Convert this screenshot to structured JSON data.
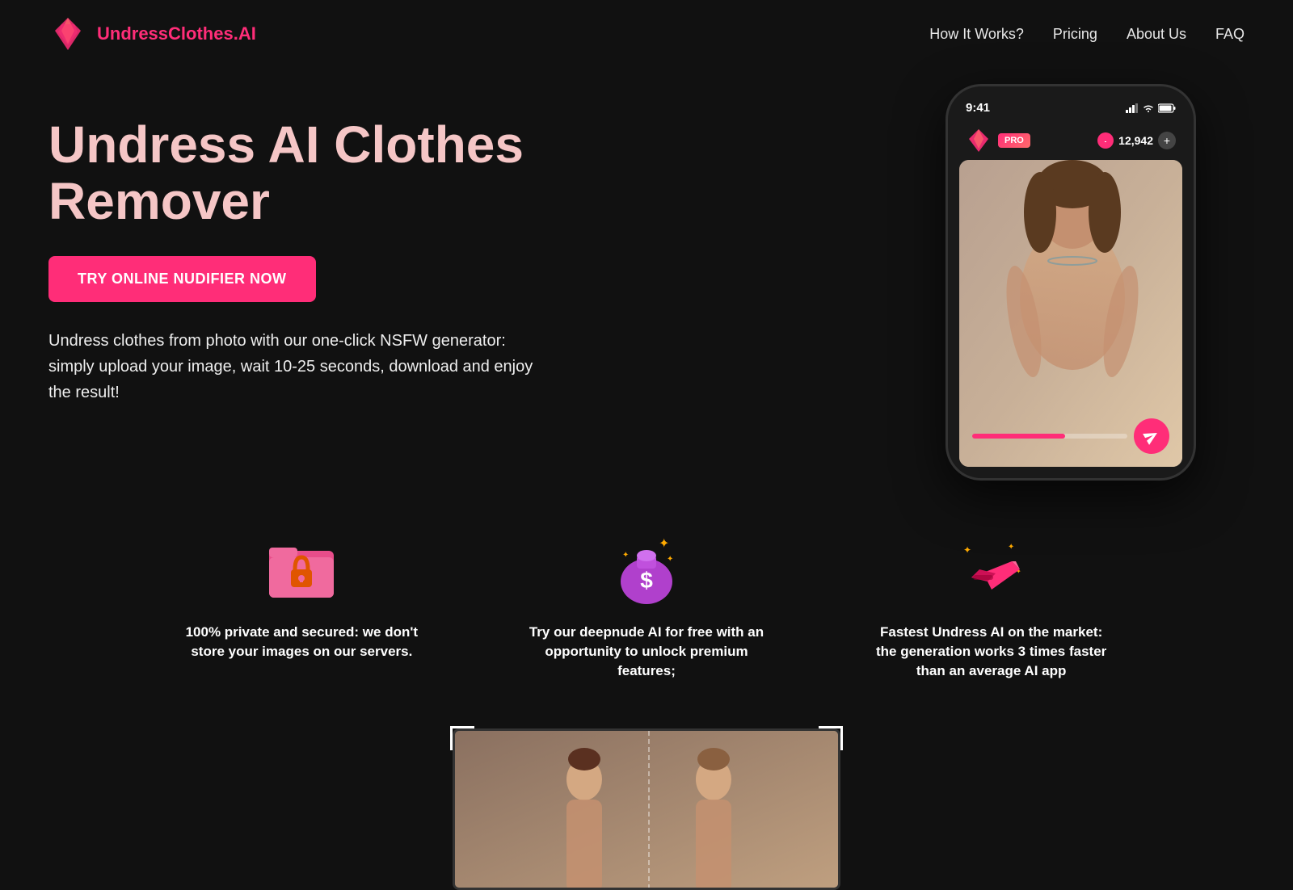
{
  "header": {
    "logo_text_main": "UndressClothes.",
    "logo_text_accent": "AI",
    "nav": [
      {
        "label": "How It Works?",
        "href": "#how"
      },
      {
        "label": "Pricing",
        "href": "#pricing"
      },
      {
        "label": "About Us",
        "href": "#about"
      },
      {
        "label": "FAQ",
        "href": "#faq"
      }
    ]
  },
  "hero": {
    "title": "Undress AI Clothes Remover",
    "cta_label": "TRY ONLINE NUDIFIER NOW",
    "description": "Undress clothes from photo with our one-click NSFW generator: simply upload your image, wait 10-25 seconds, download and enjoy the result!",
    "phone": {
      "time": "9:41",
      "pro_label": "PRO",
      "coin_count": "12,942"
    }
  },
  "features": [
    {
      "icon_label": "lock-icon",
      "icon_emoji": "🔒",
      "text": "100% private and secured: we don't store your images on our servers."
    },
    {
      "icon_label": "money-icon",
      "icon_emoji": "💰",
      "text": "Try our deepnude AI for free with an opportunity to unlock premium features;"
    },
    {
      "icon_label": "speed-icon",
      "icon_emoji": "⚡",
      "text": "Fastest Undress AI on the market: the generation works 3 times faster than an average AI app"
    }
  ],
  "colors": {
    "accent": "#ff2d78",
    "background": "#111111",
    "text_primary": "#ffffff",
    "text_muted": "#eeeeee",
    "hero_title": "#f5c6c6"
  }
}
